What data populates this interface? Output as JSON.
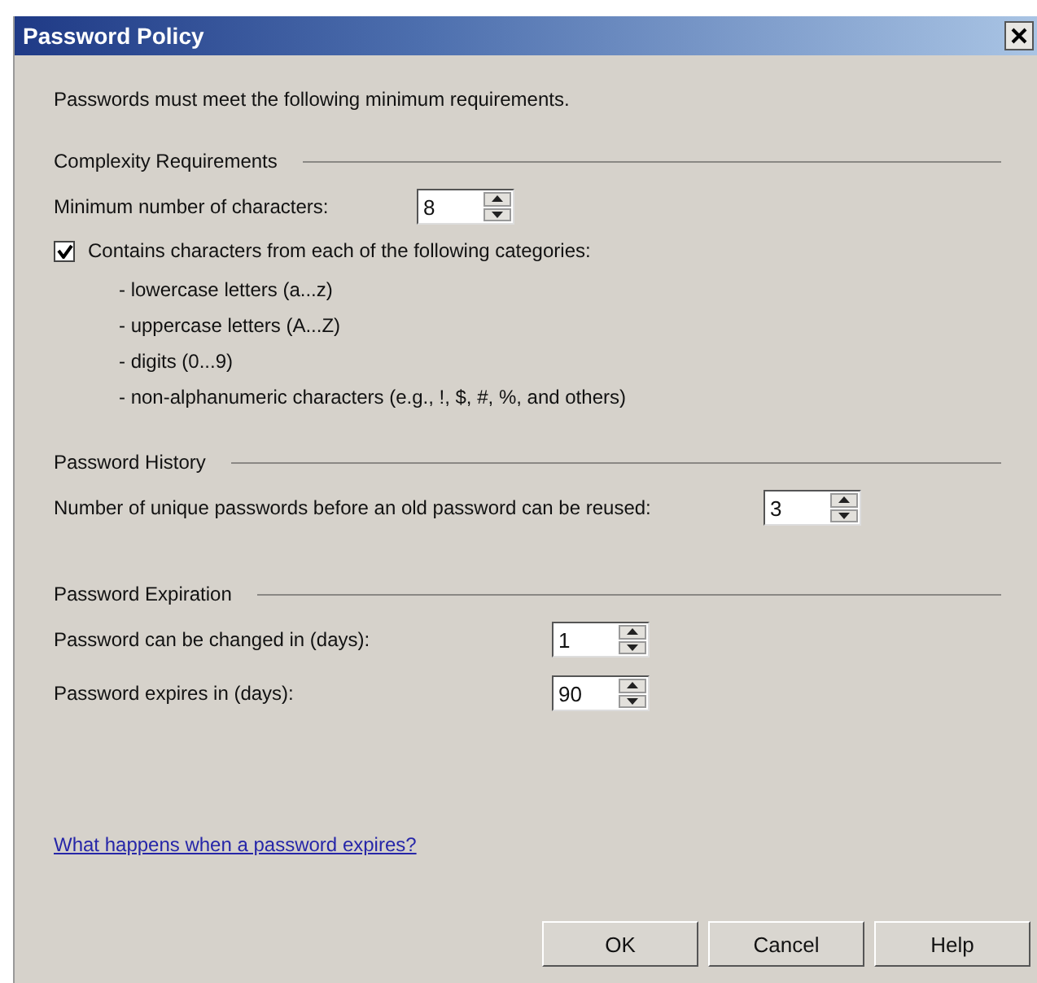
{
  "window": {
    "title": "Password Policy"
  },
  "intro": "Passwords must meet the following minimum requirements.",
  "sections": [
    {
      "heading": "Complexity Requirements",
      "rows": [
        {
          "kind": "spinner",
          "label": "Minimum number of characters:",
          "value": "8"
        },
        {
          "kind": "checkbox",
          "label": "Contains characters from each of the following categories:",
          "checked": true,
          "items": [
            "- lowercase letters (a...z)",
            "- uppercase letters (A...Z)",
            "- digits (0...9)",
            "- non-alphanumeric characters (e.g., !, $, #, %, and others)"
          ]
        }
      ]
    },
    {
      "heading": "Password History",
      "rows": [
        {
          "kind": "spinner",
          "label": "Number of unique passwords before an old password can be reused:",
          "value": "3"
        }
      ]
    },
    {
      "heading": "Password Expiration",
      "rows": [
        {
          "kind": "spinner",
          "label": "Password can be changed in (days):",
          "value": "1"
        },
        {
          "kind": "spinner",
          "label": "Password expires in (days):",
          "value": "90"
        }
      ]
    }
  ],
  "link": "What happens when a password expires?",
  "buttons": [
    "OK",
    "Cancel",
    "Help"
  ]
}
